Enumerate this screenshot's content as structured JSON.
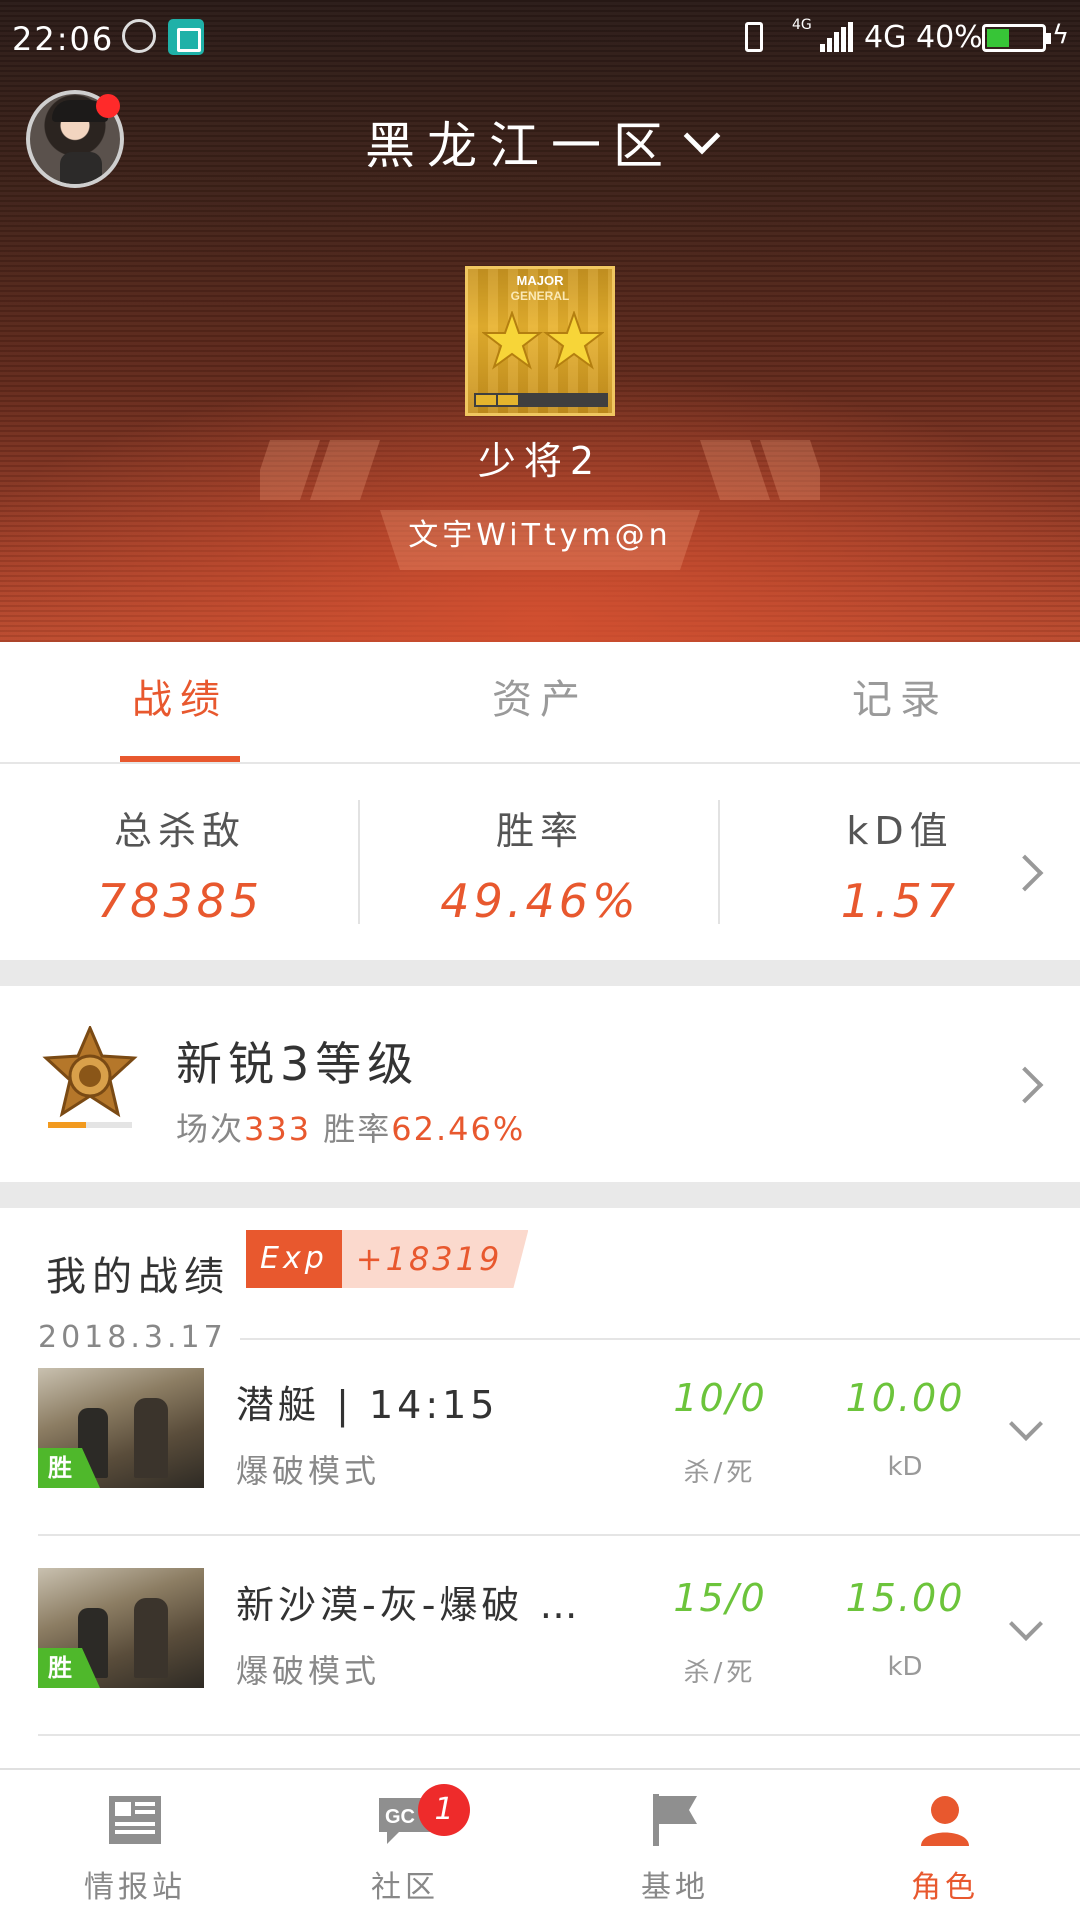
{
  "status_bar": {
    "time": "22:06",
    "network_small": "4G",
    "network": "4G",
    "battery_pct": "40%",
    "battery_level": 0.4
  },
  "header": {
    "server": "黑龙江一区",
    "rank_badge": {
      "line1": "MAJOR",
      "line2": "GENERAL",
      "stars": 2,
      "progress": 0.3
    },
    "rank_name": "少将2",
    "player_name": "文宇WiTtym@n",
    "avatar_notification": true
  },
  "tabs": [
    {
      "label": "战绩",
      "active": true
    },
    {
      "label": "资产",
      "active": false
    },
    {
      "label": "记录",
      "active": false
    }
  ],
  "stats": [
    {
      "label": "总杀敌",
      "value": "78385"
    },
    {
      "label": "胜率",
      "value": "49.46%"
    },
    {
      "label": "kD值",
      "value": "1.57"
    }
  ],
  "level": {
    "title": "新锐3等级",
    "sub_prefix": "场次",
    "matches": "333",
    "winrate_label": " 胜率",
    "winrate": "62.46%",
    "progress": 0.45
  },
  "records": {
    "title": "我的战绩",
    "exp_label": "Exp",
    "exp_value": "+18319",
    "date": "2018.3.17",
    "matches": [
      {
        "map": "潜艇 | 14:15",
        "mode": "爆破模式",
        "kd_count": "10/0",
        "kd_count_label": "杀/死",
        "kd_ratio": "10.00",
        "kd_ratio_label": "kD",
        "result": "胜"
      },
      {
        "map": "新沙漠-灰-爆破 …",
        "mode": "爆破模式",
        "kd_count": "15/0",
        "kd_count_label": "杀/死",
        "kd_ratio": "15.00",
        "kd_ratio_label": "kD",
        "result": "胜"
      }
    ]
  },
  "bottom_nav": [
    {
      "label": "情报站",
      "icon": "news-icon",
      "active": false
    },
    {
      "label": "社区",
      "icon": "community-chat-icon",
      "active": false,
      "badge": "1"
    },
    {
      "label": "基地",
      "icon": "flag-icon",
      "active": false
    },
    {
      "label": "角色",
      "icon": "profile-icon",
      "active": true
    }
  ],
  "colors": {
    "accent": "#e8582e",
    "win_green": "#6cc43b",
    "win_tag": "#4fb82b",
    "badge_red": "#ee2b2b"
  }
}
